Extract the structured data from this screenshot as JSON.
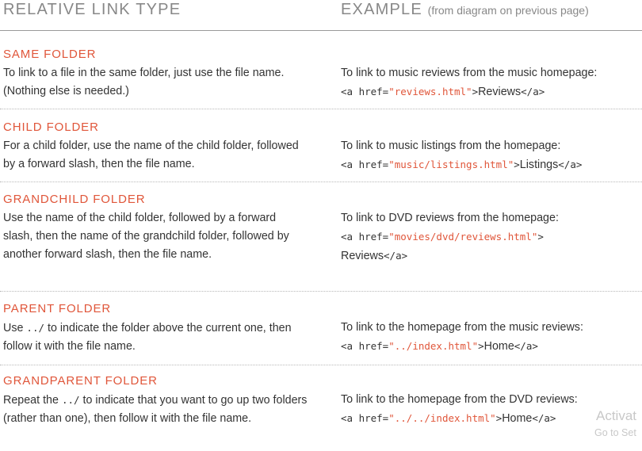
{
  "header": {
    "left": "RELATIVE LINK TYPE",
    "right": "EXAMPLE",
    "right_note": "(from diagram on previous page)"
  },
  "rows": [
    {
      "title": "SAME FOLDER",
      "description": "To link to a file in the same folder, just use the file name. (Nothing else is needed.)",
      "example_intro": "To link to music reviews from the music homepage:",
      "code_open": "<a href=",
      "code_href": "\"reviews.html\"",
      "code_close": ">",
      "link_text": "Reviews",
      "code_end": "</a>"
    },
    {
      "title": "CHILD FOLDER",
      "description": "For a child folder, use the name of the child folder, followed by a forward slash, then the file name.",
      "example_intro": "To link to music listings from the homepage:",
      "code_open": "<a href=",
      "code_href": "\"music/listings.html\"",
      "code_close": ">",
      "link_text": "Listings",
      "code_end": "</a>"
    },
    {
      "title": "GRANDCHILD FOLDER",
      "description": "Use the name of the child folder, followed by a forward slash, then the name of the grandchild folder, followed by another forward slash, then the file name.",
      "example_intro": "To link to DVD reviews from the homepage:",
      "code_open": "<a href=",
      "code_href": "\"movies/dvd/reviews.html\"",
      "code_close": ">",
      "link_text": "Reviews",
      "code_end": "</a>"
    },
    {
      "title": "PARENT FOLDER",
      "desc_pre": "Use",
      "desc_code": "../",
      "desc_post": "to indicate the folder above the current one, then follow it with the file name.",
      "example_intro": "To link to the homepage from the music reviews:",
      "code_open": "<a href=",
      "code_href": "\"../index.html\"",
      "code_close": ">",
      "link_text": "Home",
      "code_end": "</a>"
    },
    {
      "title": "GRANDPARENT FOLDER",
      "desc_pre": "Repeat the",
      "desc_code": "../",
      "desc_post": "to indicate that you want to go up two folders (rather than one), then follow it with the file name.",
      "example_intro": "To link to the homepage from the DVD reviews:",
      "code_open": "<a href=",
      "code_href": "\"../../index.html\"",
      "code_close": ">",
      "link_text": "Home",
      "code_end": "</a>"
    }
  ],
  "watermark": {
    "line1": "Activat",
    "line2": "Go to Set"
  }
}
